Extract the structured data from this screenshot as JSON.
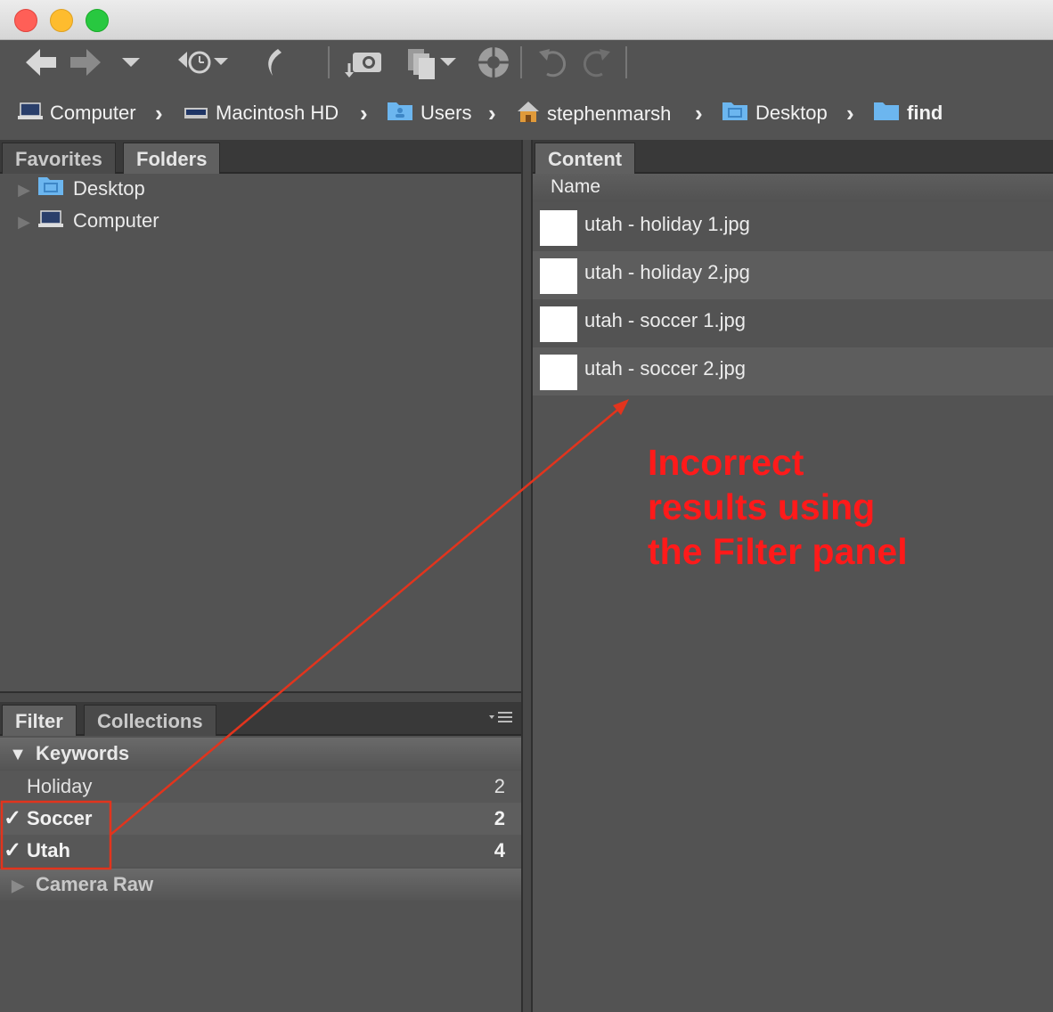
{
  "window": {
    "traffic_lights": [
      "#ff5f57",
      "#febc2e",
      "#28c840"
    ]
  },
  "toolbar": {
    "icons": [
      "back-arrow-icon",
      "forward-arrow-icon",
      "recent-dropdown-icon",
      "reveal-recent-icon",
      "boomerang-icon",
      "get-photos-icon",
      "refine-icon",
      "open-in-camera-raw-icon",
      "rotate-left-icon",
      "rotate-right-icon"
    ]
  },
  "breadcrumb": {
    "items": [
      {
        "label": "Computer",
        "icon": "computer-icon"
      },
      {
        "label": "Macintosh HD",
        "icon": "drive-icon"
      },
      {
        "label": "Users",
        "icon": "users-folder-icon"
      },
      {
        "label": "stephenmarsh",
        "icon": "home-icon"
      },
      {
        "label": "Desktop",
        "icon": "desktop-folder-icon"
      },
      {
        "label": "find",
        "icon": "folder-icon"
      }
    ]
  },
  "left_panel": {
    "tabs": [
      "Favorites",
      "Folders"
    ],
    "tree": [
      {
        "label": "Desktop",
        "icon": "desktop-folder-icon"
      },
      {
        "label": "Computer",
        "icon": "computer-icon"
      }
    ]
  },
  "filter_panel": {
    "tabs": [
      "Filter",
      "Collections"
    ],
    "keywords_header": "Keywords",
    "keywords": [
      {
        "label": "Holiday",
        "count": "2",
        "checked": false
      },
      {
        "label": "Soccer",
        "count": "2",
        "checked": true
      },
      {
        "label": "Utah",
        "count": "4",
        "checked": true
      }
    ],
    "camera_raw_header": "Camera Raw",
    "check_mark": "✓"
  },
  "content_panel": {
    "tab": "Content",
    "column_header": "Name",
    "files": [
      {
        "name": "utah - holiday 1.jpg"
      },
      {
        "name": "utah - holiday 2.jpg"
      },
      {
        "name": "utah - soccer 1.jpg"
      },
      {
        "name": "utah - soccer 2.jpg"
      }
    ]
  },
  "annotation": {
    "lines": [
      "Incorrect",
      "results using",
      "the Filter panel"
    ],
    "color": "#ff1a1a"
  }
}
